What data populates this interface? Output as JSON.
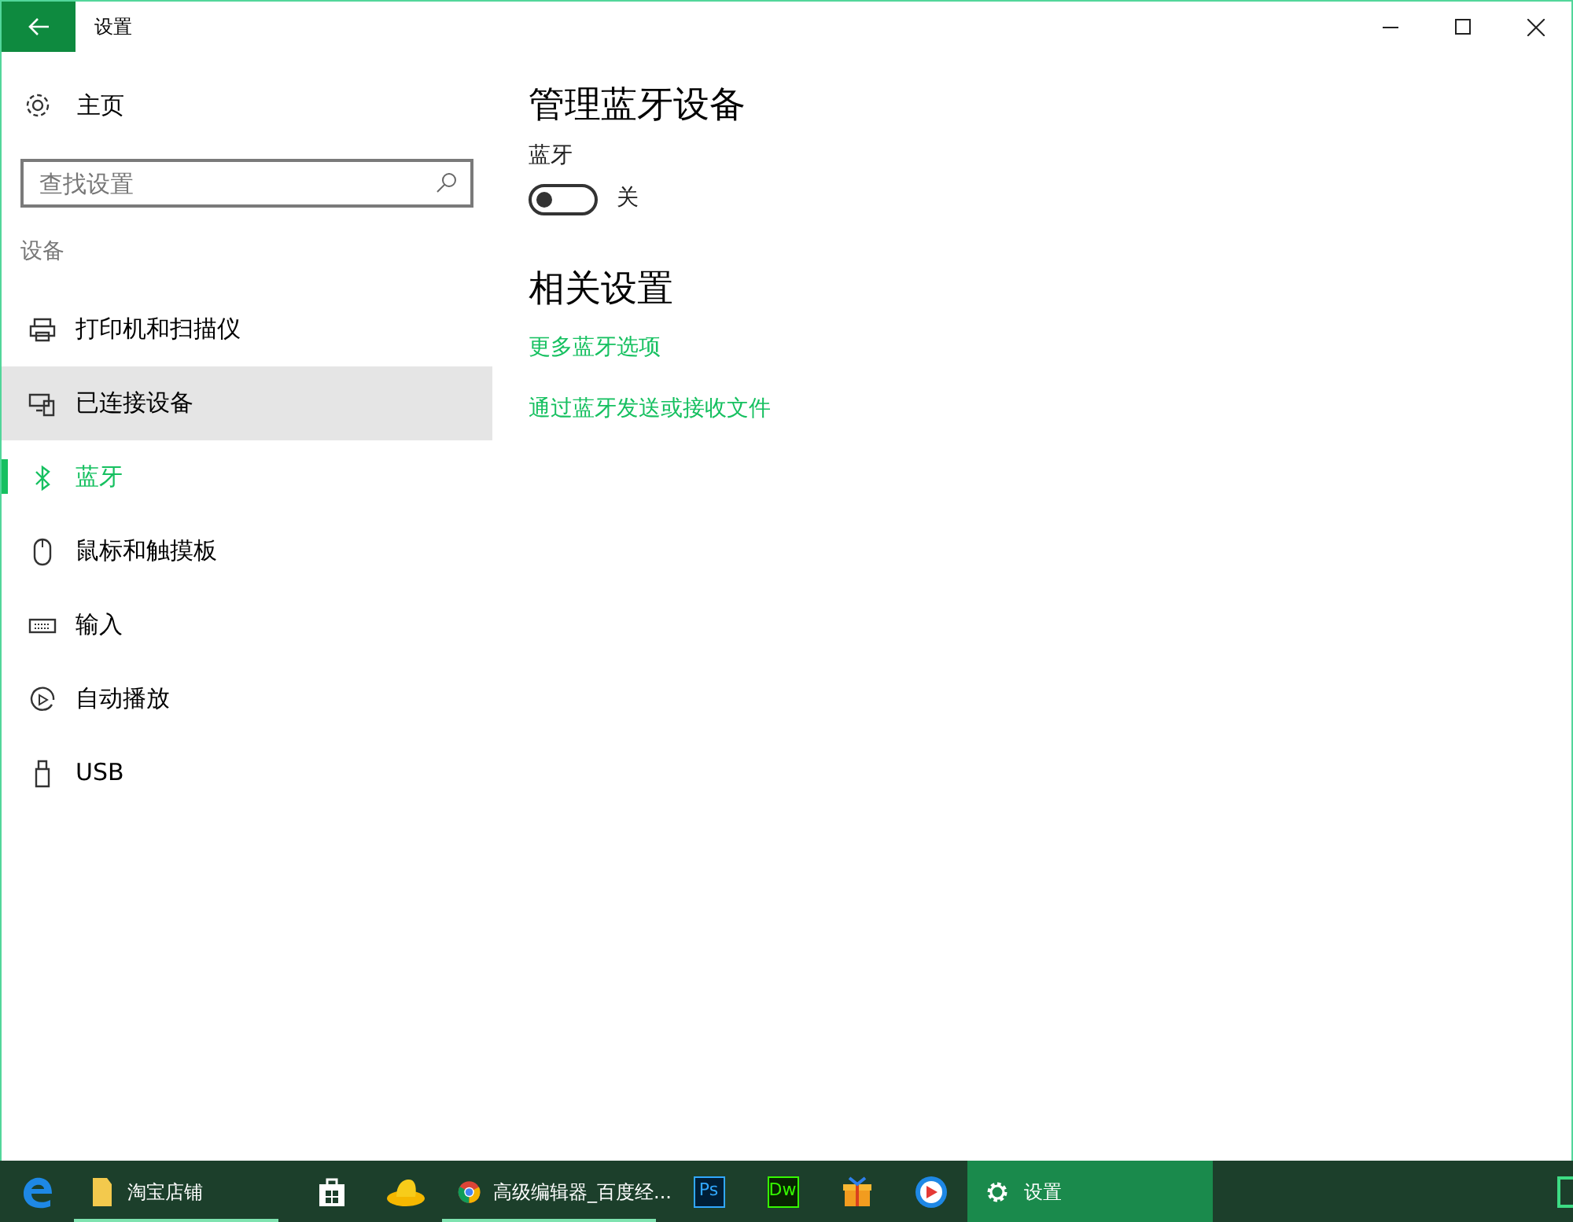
{
  "window": {
    "title": "设置"
  },
  "sidebar": {
    "home": "主页",
    "search": {
      "placeholder": "查找设置"
    },
    "section": "设备",
    "items": [
      {
        "label": "打印机和扫描仪",
        "kind": "printer",
        "selected": false,
        "highlighted": false
      },
      {
        "label": "已连接设备",
        "kind": "devices",
        "selected": false,
        "highlighted": true
      },
      {
        "label": "蓝牙",
        "kind": "bluetooth",
        "selected": true,
        "highlighted": false
      },
      {
        "label": "鼠标和触摸板",
        "kind": "mouse",
        "selected": false,
        "highlighted": false
      },
      {
        "label": "输入",
        "kind": "keyboard",
        "selected": false,
        "highlighted": false
      },
      {
        "label": "自动播放",
        "kind": "autoplay",
        "selected": false,
        "highlighted": false
      },
      {
        "label": "USB",
        "kind": "usb",
        "selected": false,
        "highlighted": false
      }
    ]
  },
  "main": {
    "heading": "管理蓝牙设备",
    "toggle": {
      "label": "蓝牙",
      "on": false,
      "state_text": "关"
    },
    "related_heading": "相关设置",
    "links": [
      "更多蓝牙选项",
      "通过蓝牙发送或接收文件"
    ]
  },
  "taskbar": [
    {
      "kind": "edge",
      "running": false,
      "selected": false
    },
    {
      "kind": "folder",
      "label": "淘宝店铺",
      "running": true,
      "selected": false
    },
    {
      "kind": "store",
      "running": false,
      "selected": false
    },
    {
      "kind": "hat",
      "running": false,
      "selected": false
    },
    {
      "kind": "chrome",
      "label": "高级编辑器_百度经...",
      "running": true,
      "selected": false
    },
    {
      "kind": "ps",
      "text": "Ps",
      "running": false,
      "selected": false
    },
    {
      "kind": "dw",
      "text": "Dw",
      "running": false,
      "selected": false
    },
    {
      "kind": "box",
      "running": false,
      "selected": false
    },
    {
      "kind": "player",
      "running": false,
      "selected": false
    },
    {
      "kind": "gear",
      "label": "设置",
      "running": false,
      "selected": true
    }
  ]
}
